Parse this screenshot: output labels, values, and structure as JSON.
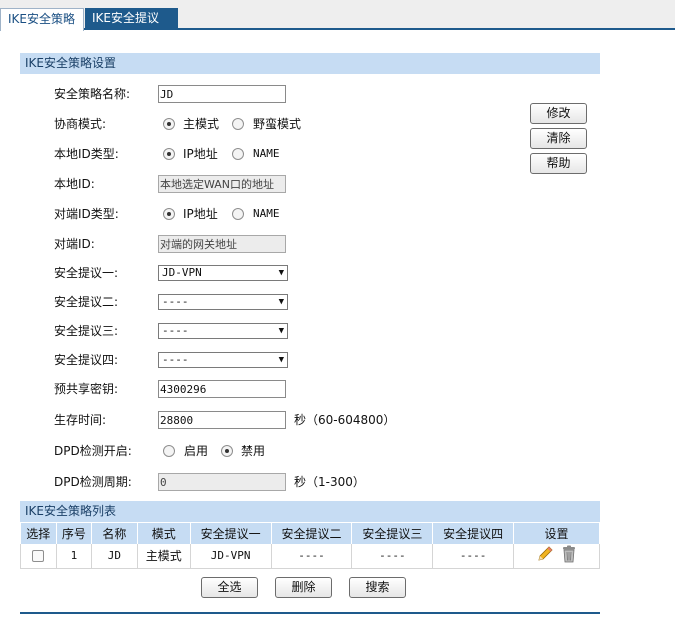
{
  "tabs": [
    {
      "label": "IKE安全策略"
    },
    {
      "label": "IKE安全提议"
    }
  ],
  "settings_title": "IKE安全策略设置",
  "fields": {
    "policy_name": {
      "label": "安全策略名称:",
      "value": "JD"
    },
    "mode": {
      "label": "协商模式:",
      "options": [
        "主模式",
        "野蛮模式"
      ],
      "selected": "主模式"
    },
    "local_id_type": {
      "label": "本地ID类型:",
      "options": [
        "IP地址",
        "NAME"
      ],
      "selected": "IP地址"
    },
    "local_id": {
      "label": "本地ID:",
      "value": "本地选定WAN口的地址"
    },
    "remote_id_type": {
      "label": "对端ID类型:",
      "options": [
        "IP地址",
        "NAME"
      ],
      "selected": "IP地址"
    },
    "remote_id": {
      "label": "对端ID:",
      "value": "对端的网关地址"
    },
    "proposal1": {
      "label": "安全提议一:",
      "value": "JD-VPN"
    },
    "proposal2": {
      "label": "安全提议二:",
      "value": "----"
    },
    "proposal3": {
      "label": "安全提议三:",
      "value": "----"
    },
    "proposal4": {
      "label": "安全提议四:",
      "value": "----"
    },
    "psk": {
      "label": "预共享密钥:",
      "value": "4300296"
    },
    "lifetime": {
      "label": "生存时间:",
      "value": "28800",
      "unit": "秒（60-604800）"
    },
    "dpd": {
      "label": "DPD检测开启:",
      "options": [
        "启用",
        "禁用"
      ],
      "selected": "禁用"
    },
    "dpd_period": {
      "label": "DPD检测周期:",
      "value": "0",
      "unit": "秒（1-300）"
    }
  },
  "side_buttons": {
    "modify": "修改",
    "clear": "清除",
    "help": "帮助"
  },
  "list": {
    "title": "IKE安全策略列表",
    "headers": [
      "选择",
      "序号",
      "名称",
      "模式",
      "安全提议一",
      "安全提议二",
      "安全提议三",
      "安全提议四",
      "设置"
    ],
    "rows": [
      {
        "index": "1",
        "name": "JD",
        "mode": "主模式",
        "p1": "JD-VPN",
        "p2": "----",
        "p3": "----",
        "p4": "----"
      }
    ]
  },
  "bottom_buttons": {
    "select_all": "全选",
    "delete": "删除",
    "search": "搜索"
  },
  "icons": {
    "edit": "pencil-icon",
    "delete": "trash-icon"
  },
  "colors": {
    "accent": "#1e5a8c",
    "section_bg": "#c6dcf3"
  }
}
